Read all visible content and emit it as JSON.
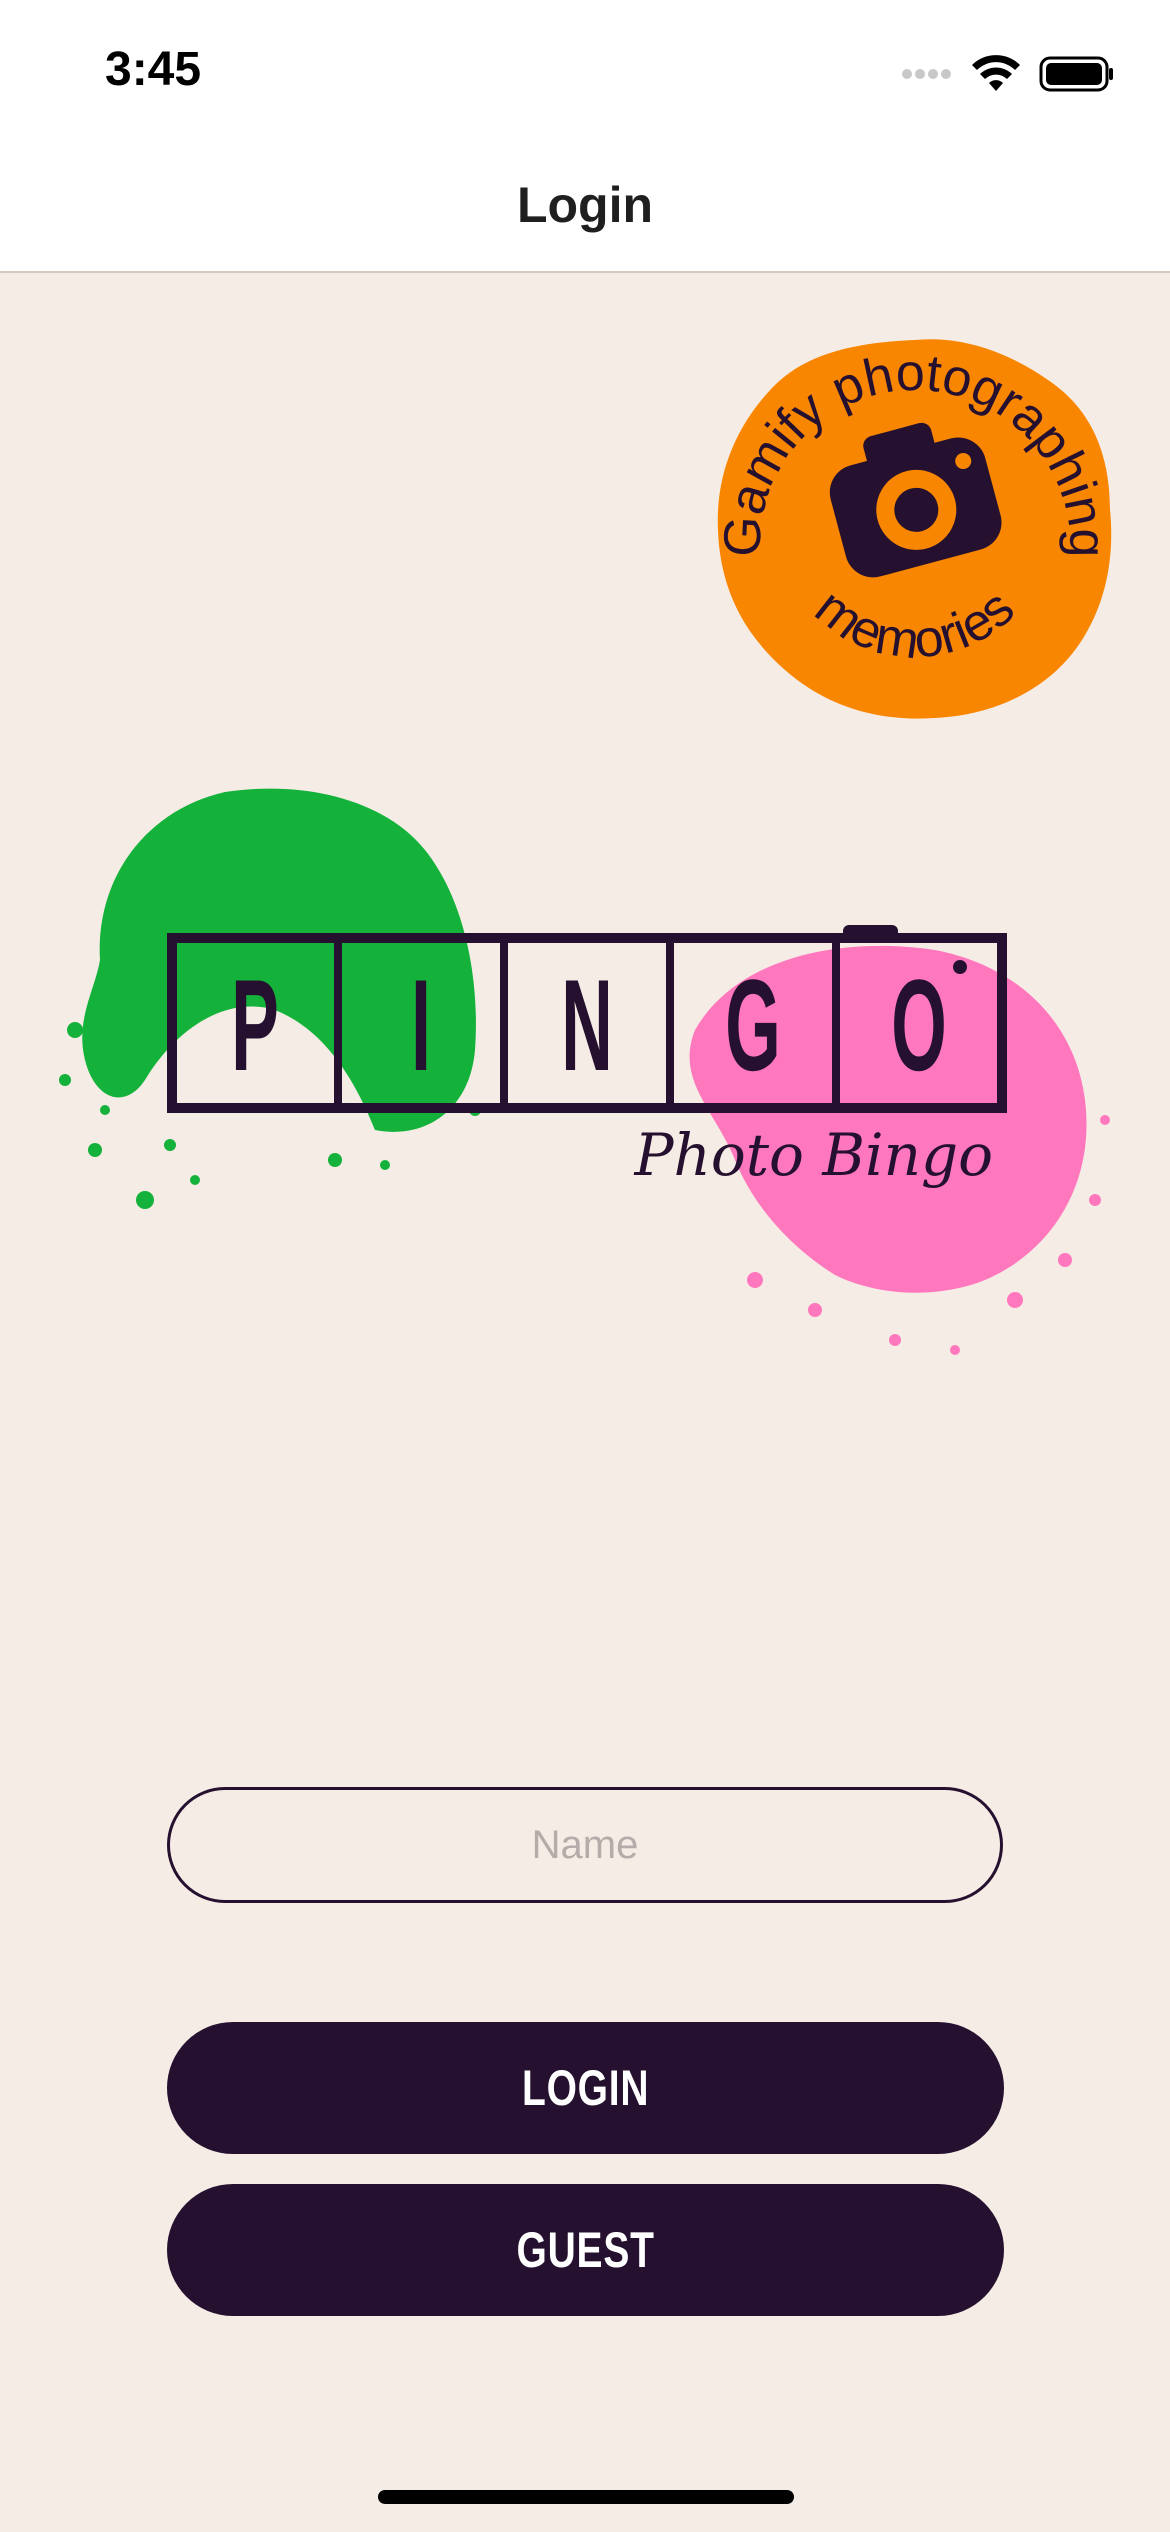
{
  "status_bar": {
    "time": "3:45",
    "icons": [
      "cellular-dots-icon",
      "wifi-icon",
      "battery-icon"
    ]
  },
  "nav": {
    "title": "Login"
  },
  "badge": {
    "arc_text": "Gamify photographing",
    "bottom_text": "memories",
    "icon": "camera-icon",
    "color": "#f98600"
  },
  "logo": {
    "letters": [
      "P",
      "I",
      "N",
      "G",
      "O"
    ],
    "tagline": "Photo Bingo",
    "colors": {
      "green": "#14b23b",
      "pink": "#ff78bd",
      "ink": "#25112f"
    }
  },
  "form": {
    "name_placeholder": "Name",
    "name_value": ""
  },
  "buttons": {
    "login_label": "LOGIN",
    "guest_label": "GUEST"
  },
  "colors": {
    "background": "#f6ece6",
    "primary": "#25112f",
    "bar": "#ffffff"
  }
}
